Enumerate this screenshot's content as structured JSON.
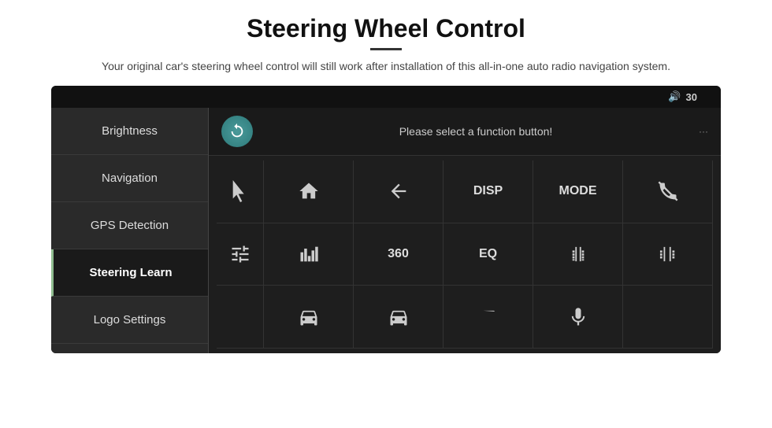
{
  "page": {
    "title": "Steering Wheel Control",
    "divider": true,
    "subtitle": "Your original car's steering wheel control will still work after installation of this all-in-one auto radio navigation system."
  },
  "screen": {
    "topbar": {
      "volume_icon": "🔊",
      "volume_value": "30"
    },
    "sidebar": {
      "items": [
        {
          "id": "brightness",
          "label": "Brightness",
          "active": false
        },
        {
          "id": "navigation",
          "label": "Navigation",
          "active": false
        },
        {
          "id": "gps-detection",
          "label": "GPS Detection",
          "active": false
        },
        {
          "id": "steering-learn",
          "label": "Steering Learn",
          "active": true
        },
        {
          "id": "logo-settings",
          "label": "Logo Settings",
          "active": false
        }
      ]
    },
    "function_bar": {
      "prompt": "Please select a function button!"
    },
    "buttons": {
      "row1": [
        "home",
        "back",
        "DISP",
        "MODE",
        "no-call"
      ],
      "row2": [
        "equalizer",
        "360",
        "EQ",
        "beer1",
        "beer2"
      ],
      "row3": [
        "car1",
        "car2",
        "car3",
        "mic",
        ""
      ],
      "cursor_row": 1,
      "cursor_col": 0
    }
  }
}
